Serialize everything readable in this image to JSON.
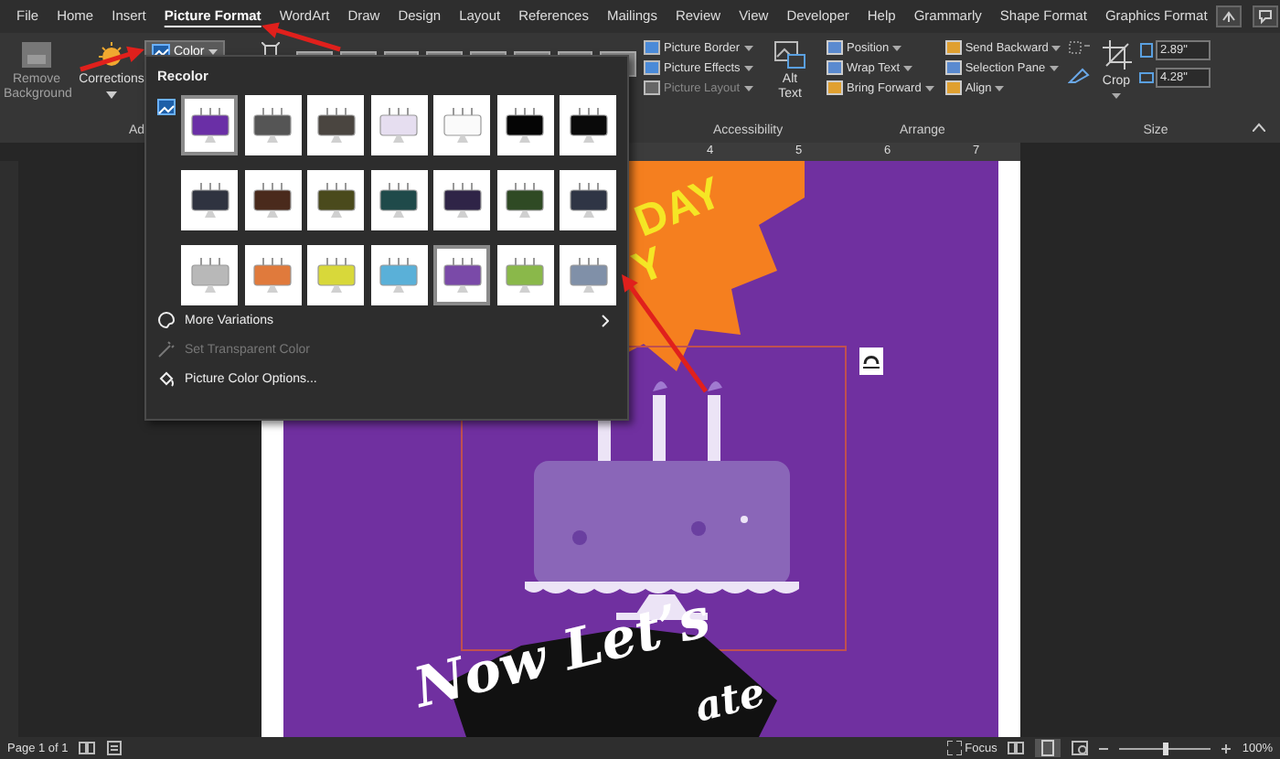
{
  "menu_tabs": [
    {
      "label": "File",
      "selected": false
    },
    {
      "label": "Home",
      "selected": false
    },
    {
      "label": "Insert",
      "selected": false
    },
    {
      "label": "Picture Format",
      "selected": true
    },
    {
      "label": "WordArt",
      "selected": false
    },
    {
      "label": "Draw",
      "selected": false
    },
    {
      "label": "Design",
      "selected": false
    },
    {
      "label": "Layout",
      "selected": false
    },
    {
      "label": "References",
      "selected": false
    },
    {
      "label": "Mailings",
      "selected": false
    },
    {
      "label": "Review",
      "selected": false
    },
    {
      "label": "View",
      "selected": false
    },
    {
      "label": "Developer",
      "selected": false
    },
    {
      "label": "Help",
      "selected": false
    },
    {
      "label": "Grammarly",
      "selected": false
    },
    {
      "label": "Shape Format",
      "selected": false
    },
    {
      "label": "Graphics Format",
      "selected": false
    }
  ],
  "ribbon": {
    "remove_background": {
      "label": "Remove Background",
      "disabled": true
    },
    "corrections": {
      "label": "Corrections"
    },
    "adjust_group_label": "Ad",
    "color_button": {
      "label": "Color",
      "expanded": true
    },
    "picture_group": [
      {
        "label": "Picture Border",
        "disabled": false
      },
      {
        "label": "Picture Effects",
        "disabled": false
      },
      {
        "label": "Picture Layout",
        "disabled": true
      }
    ],
    "alt_text": "Alt Text",
    "accessibility_label": "Accessibility",
    "arrange": [
      {
        "label": "Position"
      },
      {
        "label": "Wrap Text"
      },
      {
        "label": "Bring Forward"
      },
      {
        "label": "Send Backward"
      },
      {
        "label": "Selection Pane"
      },
      {
        "label": "Align"
      }
    ],
    "arrange_label": "Arrange",
    "crop": "Crop",
    "height": "2.89\"",
    "width": "4.28\"",
    "size_label": "Size"
  },
  "ruler_numbers": [
    "4",
    "5",
    "6",
    "7"
  ],
  "recolor_menu": {
    "heading": "Recolor",
    "swatches": [
      {
        "color": "#6a2fa6",
        "selected": true
      },
      {
        "color": "#555555",
        "selected": false
      },
      {
        "color": "#4a4540",
        "selected": false
      },
      {
        "color": "#e6def0",
        "selected": false
      },
      {
        "color": "#fafafa",
        "selected": false
      },
      {
        "color": "#050505",
        "selected": false
      },
      {
        "color": "#0a0a0a",
        "selected": false
      },
      {
        "color": "#2f3340",
        "selected": false
      },
      {
        "color": "#4a2a1c",
        "selected": false
      },
      {
        "color": "#4a4a1c",
        "selected": false
      },
      {
        "color": "#1f4a4a",
        "selected": false
      },
      {
        "color": "#2f2447",
        "selected": false
      },
      {
        "color": "#2f4a24",
        "selected": false
      },
      {
        "color": "#2f3545",
        "selected": false
      },
      {
        "color": "#b8b8b8",
        "selected": false
      },
      {
        "color": "#e07a3c",
        "selected": false
      },
      {
        "color": "#d8d83a",
        "selected": false
      },
      {
        "color": "#5ab0d8",
        "selected": false
      },
      {
        "color": "#7a4aa8",
        "selected": true
      },
      {
        "color": "#8ab84a",
        "selected": false
      },
      {
        "color": "#8090a8",
        "selected": false
      }
    ],
    "items": [
      {
        "label": "More Variations",
        "kind": "submenu",
        "disabled": false
      },
      {
        "label": "Set Transparent Color",
        "kind": "picker",
        "disabled": true
      },
      {
        "label": "Picture Color Options...",
        "kind": "options",
        "disabled": false
      }
    ]
  },
  "poster": {
    "banner_lines": [
      "DAY",
      "Y"
    ],
    "headline_lines": [
      "Now Let’s",
      "ate"
    ]
  },
  "status_bar": {
    "page": "Page 1 of 1",
    "focus": "Focus",
    "zoom": "100%",
    "zoom_slider": {
      "level": 0.5
    }
  }
}
